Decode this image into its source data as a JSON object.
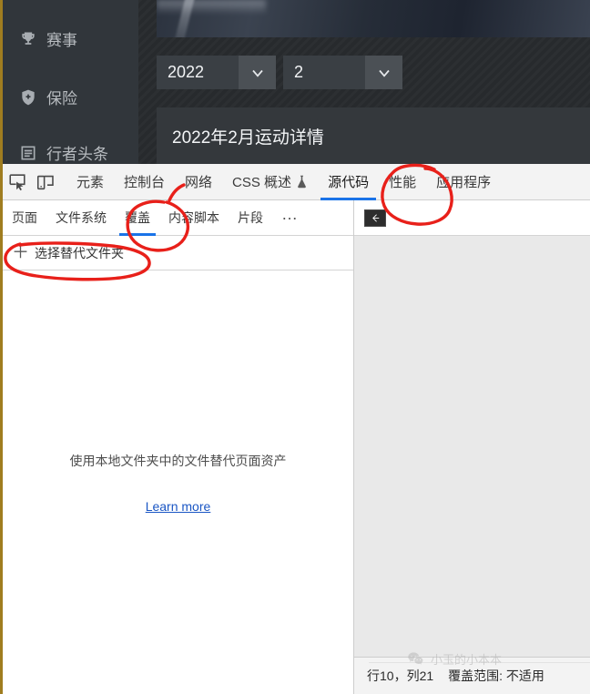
{
  "webpage": {
    "sidebar": [
      {
        "label": "赛事",
        "icon": "trophy-icon"
      },
      {
        "label": "保险",
        "icon": "shield-plus-icon"
      },
      {
        "label": "行者头条",
        "icon": "list-icon"
      }
    ],
    "year_select": {
      "value": "2022",
      "icon": "chevron-down-icon"
    },
    "month_select": {
      "value": "2",
      "icon": "chevron-down-icon"
    },
    "detail_title": "2022年2月运动详情"
  },
  "devtools": {
    "main_tabs": [
      {
        "label": "元素",
        "selected": false
      },
      {
        "label": "控制台",
        "selected": false
      },
      {
        "label": "网络",
        "selected": false
      },
      {
        "label": "CSS 概述",
        "selected": false,
        "flask": true
      },
      {
        "label": "源代码",
        "selected": true
      },
      {
        "label": "性能",
        "selected": false
      },
      {
        "label": "应用程序",
        "selected": false
      }
    ],
    "toolbar_icons": [
      {
        "name": "inspect-element-icon"
      },
      {
        "name": "device-toolbar-icon"
      }
    ],
    "sub_tabs": [
      {
        "label": "页面",
        "selected": false
      },
      {
        "label": "文件系统",
        "selected": false
      },
      {
        "label": "覆盖",
        "selected": true
      },
      {
        "label": "内容脚本",
        "selected": false
      },
      {
        "label": "片段",
        "selected": false
      },
      {
        "label": "…",
        "selected": false
      }
    ],
    "add_folder": {
      "plus": "＋",
      "label": "选择替代文件夹"
    },
    "empty_state": {
      "message": "使用本地文件夹中的文件替代页面资产",
      "link": "Learn more"
    },
    "editor": {
      "nav_toggle_icon": "collapse-navigator-icon"
    },
    "status": {
      "position": "行10，列21",
      "coverage": "覆盖范围: 不适用"
    }
  },
  "watermark": {
    "text": "小玉的小本本",
    "icon": "wechat-icon"
  },
  "annotations": {
    "circles": [
      {
        "target": "源代码 tab",
        "color": "#e8201a"
      },
      {
        "target": "覆盖 sub-tab",
        "color": "#e8201a"
      },
      {
        "target": "选择替代文件夹 button",
        "color": "#e8201a"
      }
    ]
  },
  "colors": {
    "accent_blue": "#1a73e8",
    "ink_red": "#e8201a",
    "page_gold": "#a07d20",
    "page_dark": "#2b2f33",
    "link_blue": "#1a56c4"
  }
}
